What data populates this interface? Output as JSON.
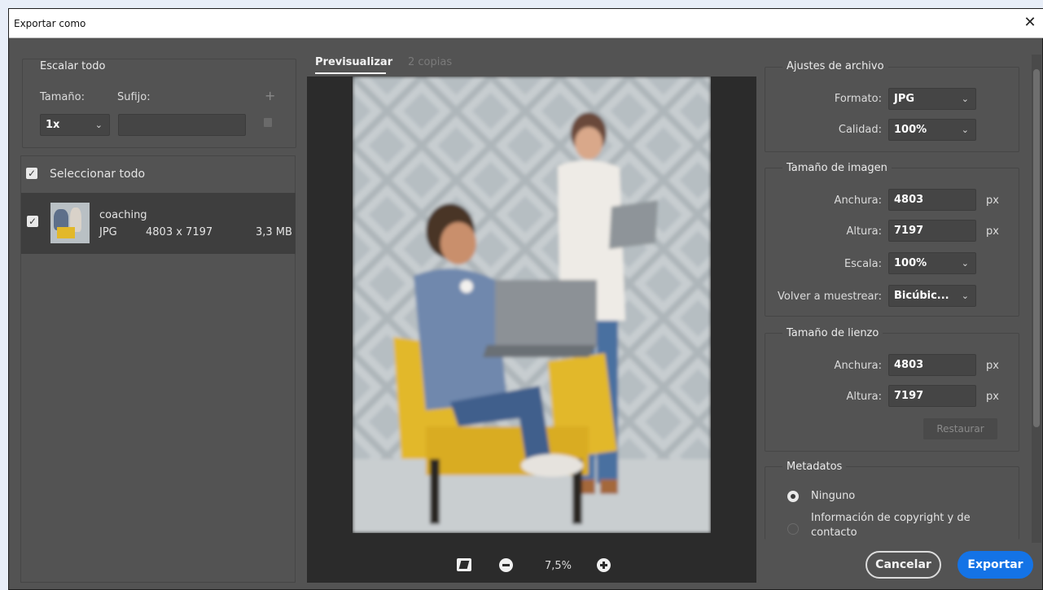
{
  "dialog": {
    "title": "Exportar como",
    "close_glyph": "✕"
  },
  "left": {
    "scale_all": {
      "legend": "Escalar todo",
      "size_label": "Tamaño:",
      "suffix_label": "Sufijo:",
      "size_value": "1x",
      "suffix_value": "",
      "add_glyph": "+",
      "trash_glyph": "🗑"
    },
    "select_all": {
      "label": "Seleccionar todo",
      "checked": true
    },
    "file_item": {
      "name": "coaching",
      "format": "JPG",
      "dimensions": "4803 x 7197",
      "size": "3,3 MB",
      "checked": true
    }
  },
  "preview": {
    "tabs": [
      {
        "label": "Previsualizar",
        "active": true
      },
      {
        "label": "2 copias",
        "active": false
      }
    ],
    "zoom": "7,5%"
  },
  "right": {
    "file_settings": {
      "legend": "Ajustes de archivo",
      "format_label": "Formato:",
      "format_value": "JPG",
      "quality_label": "Calidad:",
      "quality_value": "100%"
    },
    "image_size": {
      "legend": "Tamaño de imagen",
      "width_label": "Anchura:",
      "width_value": "4803",
      "height_label": "Altura:",
      "height_value": "7197",
      "unit": "px",
      "scale_label": "Escala:",
      "scale_value": "100%",
      "resample_label": "Volver a muestrear:",
      "resample_value": "Bicúbic..."
    },
    "canvas_size": {
      "legend": "Tamaño de lienzo",
      "width_label": "Anchura:",
      "width_value": "4803",
      "height_label": "Altura:",
      "height_value": "7197",
      "unit": "px",
      "reset_label": "Restaurar"
    },
    "metadata": {
      "legend": "Metadatos",
      "option_none": "Ninguno",
      "option_copyright": "Información de copyright y de contacto"
    }
  },
  "footer": {
    "cancel_label": "Cancelar",
    "export_label": "Exportar"
  },
  "colors": {
    "accent": "#1473e6",
    "panel": "#535353",
    "preview_bg": "#2b2b2b"
  }
}
